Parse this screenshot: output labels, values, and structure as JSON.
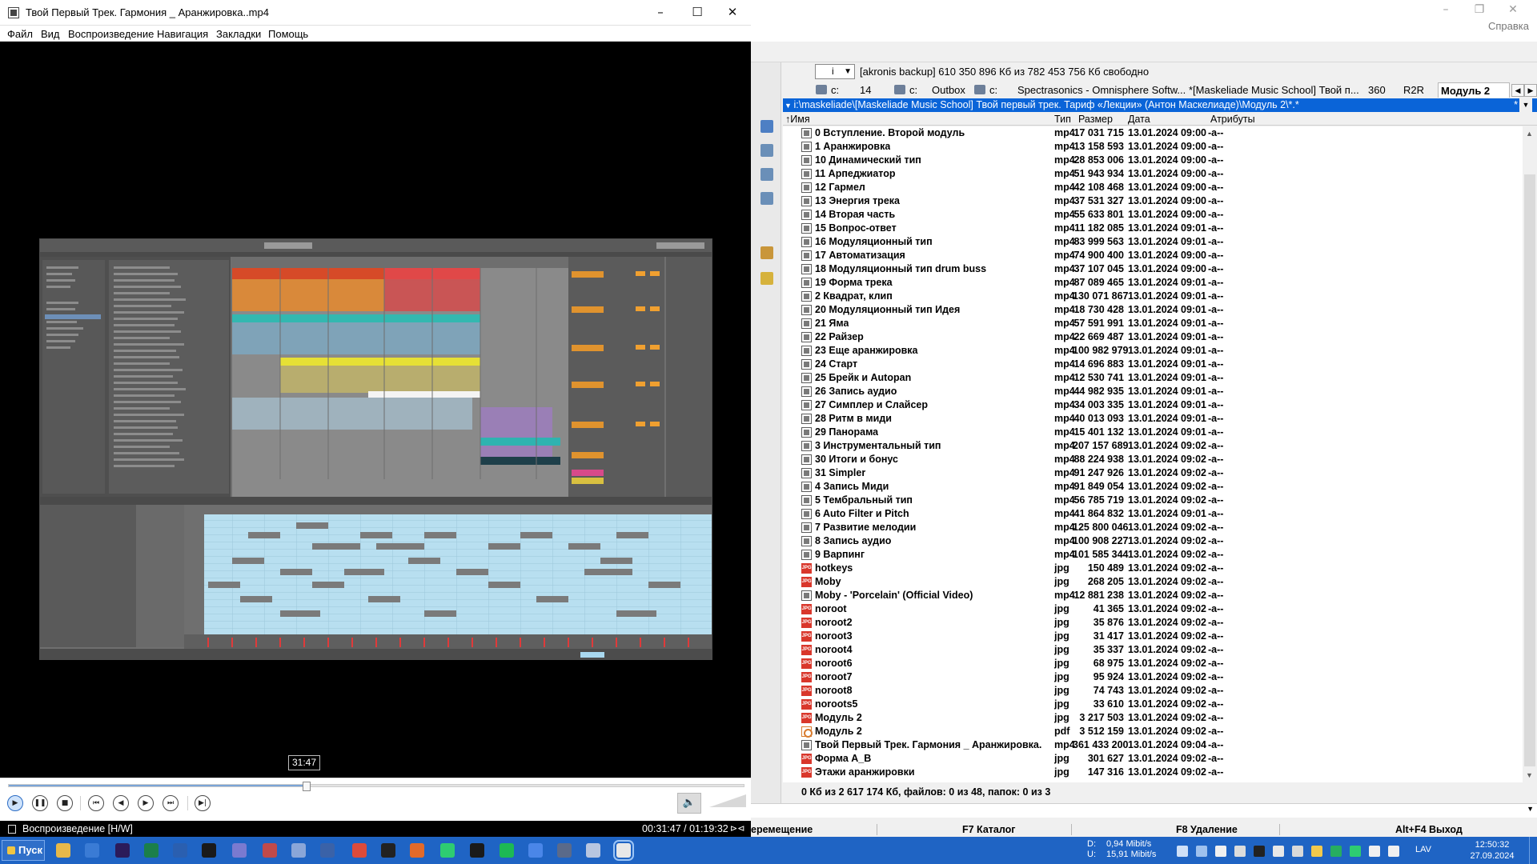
{
  "file_manager": {
    "help_label": "Справка",
    "drive": {
      "selected": "i",
      "info": "[akronis backup]  610 350 896 Кб из 782 453 756 Кб свободно",
      "root": "\\",
      "parent": ".."
    },
    "tabs": [
      {
        "label": "c:"
      },
      {
        "label": "14"
      },
      {
        "label": "c:"
      },
      {
        "label": "Outbox"
      },
      {
        "label": "c:"
      },
      {
        "label": "Spectrasonics - Omnisphere Softw..."
      },
      {
        "label": "*[Maskeliade Music School] Твой п..."
      },
      {
        "label": "360"
      },
      {
        "label": "R2R"
      },
      {
        "label": "Модуль 2"
      }
    ],
    "path": "i:\\maskeliade\\[Maskeliade Music School] Твой первый трек. Тариф «Лекции» (Антон Маскелиаде)\\Модуль 2\\*.*",
    "path_filter": "*",
    "columns": {
      "name": "↑Имя",
      "type": "Тип",
      "size": "Размер",
      "date": "Дата",
      "attrs": "Атрибуты"
    },
    "files": [
      {
        "name": "0 Вступление. Второй модуль",
        "type": "mp4",
        "size": "17 031 715",
        "date": "13.01.2024 09:00",
        "attrs": "-a--",
        "icon": "video-file-icon"
      },
      {
        "name": "1 Аранжировка",
        "type": "mp4",
        "size": "13 158 593",
        "date": "13.01.2024 09:00",
        "attrs": "-a--",
        "icon": "video-file-icon"
      },
      {
        "name": "10 Динамический тип",
        "type": "mp4",
        "size": "28 853 006",
        "date": "13.01.2024 09:00",
        "attrs": "-a--",
        "icon": "video-file-icon"
      },
      {
        "name": "11 Арпеджиатор",
        "type": "mp4",
        "size": "51 943 934",
        "date": "13.01.2024 09:00",
        "attrs": "-a--",
        "icon": "video-file-icon"
      },
      {
        "name": "12 Гармел",
        "type": "mp4",
        "size": "42 108 468",
        "date": "13.01.2024 09:00",
        "attrs": "-a--",
        "icon": "video-file-icon"
      },
      {
        "name": "13 Энергия трека",
        "type": "mp4",
        "size": "37 531 327",
        "date": "13.01.2024 09:00",
        "attrs": "-a--",
        "icon": "video-file-icon"
      },
      {
        "name": "14 Вторая часть",
        "type": "mp4",
        "size": "55 633 801",
        "date": "13.01.2024 09:00",
        "attrs": "-a--",
        "icon": "video-file-icon"
      },
      {
        "name": "15 Вопрос-ответ",
        "type": "mp4",
        "size": "11 182 085",
        "date": "13.01.2024 09:01",
        "attrs": "-a--",
        "icon": "video-file-icon"
      },
      {
        "name": "16 Модуляционный тип",
        "type": "mp4",
        "size": "83 999 563",
        "date": "13.01.2024 09:01",
        "attrs": "-a--",
        "icon": "video-file-icon"
      },
      {
        "name": "17 Автоматизация",
        "type": "mp4",
        "size": "74 900 400",
        "date": "13.01.2024 09:00",
        "attrs": "-a--",
        "icon": "video-file-icon"
      },
      {
        "name": "18 Модуляционный тип drum buss",
        "type": "mp4",
        "size": "37 107 045",
        "date": "13.01.2024 09:00",
        "attrs": "-a--",
        "icon": "video-file-icon"
      },
      {
        "name": "19 Форма трека",
        "type": "mp4",
        "size": "87 089 465",
        "date": "13.01.2024 09:01",
        "attrs": "-a--",
        "icon": "video-file-icon"
      },
      {
        "name": "2 Квадрат, клип",
        "type": "mp4",
        "size": "130 071 867",
        "date": "13.01.2024 09:01",
        "attrs": "-a--",
        "icon": "video-file-icon"
      },
      {
        "name": "20 Модуляционный тип Идея",
        "type": "mp4",
        "size": "18 730 428",
        "date": "13.01.2024 09:01",
        "attrs": "-a--",
        "icon": "video-file-icon"
      },
      {
        "name": "21 Яма",
        "type": "mp4",
        "size": "57 591 991",
        "date": "13.01.2024 09:01",
        "attrs": "-a--",
        "icon": "video-file-icon"
      },
      {
        "name": "22 Райзер",
        "type": "mp4",
        "size": "22 669 487",
        "date": "13.01.2024 09:01",
        "attrs": "-a--",
        "icon": "video-file-icon"
      },
      {
        "name": "23 Еще аранжировка",
        "type": "mp4",
        "size": "100 982 979",
        "date": "13.01.2024 09:01",
        "attrs": "-a--",
        "icon": "video-file-icon"
      },
      {
        "name": "24 Старт",
        "type": "mp4",
        "size": "14 696 883",
        "date": "13.01.2024 09:01",
        "attrs": "-a--",
        "icon": "video-file-icon"
      },
      {
        "name": "25 Брейк и Autopan",
        "type": "mp4",
        "size": "12 530 741",
        "date": "13.01.2024 09:01",
        "attrs": "-a--",
        "icon": "video-file-icon"
      },
      {
        "name": "26 Запись аудио",
        "type": "mp4",
        "size": "44 982 935",
        "date": "13.01.2024 09:01",
        "attrs": "-a--",
        "icon": "video-file-icon"
      },
      {
        "name": "27 Симплер и Слайсер",
        "type": "mp4",
        "size": "34 003 335",
        "date": "13.01.2024 09:01",
        "attrs": "-a--",
        "icon": "video-file-icon"
      },
      {
        "name": "28 Ритм в миди",
        "type": "mp4",
        "size": "40 013 093",
        "date": "13.01.2024 09:01",
        "attrs": "-a--",
        "icon": "video-file-icon"
      },
      {
        "name": "29 Панорама",
        "type": "mp4",
        "size": "15 401 132",
        "date": "13.01.2024 09:01",
        "attrs": "-a--",
        "icon": "video-file-icon"
      },
      {
        "name": "3 Инструментальный тип",
        "type": "mp4",
        "size": "207 157 689",
        "date": "13.01.2024 09:02",
        "attrs": "-a--",
        "icon": "video-file-icon"
      },
      {
        "name": "30 Итоги и бонус",
        "type": "mp4",
        "size": "88 224 938",
        "date": "13.01.2024 09:02",
        "attrs": "-a--",
        "icon": "video-file-icon"
      },
      {
        "name": "31 Simpler",
        "type": "mp4",
        "size": "91 247 926",
        "date": "13.01.2024 09:02",
        "attrs": "-a--",
        "icon": "video-file-icon"
      },
      {
        "name": "4 Запись Миди",
        "type": "mp4",
        "size": "91 849 054",
        "date": "13.01.2024 09:02",
        "attrs": "-a--",
        "icon": "video-file-icon"
      },
      {
        "name": "5 Тембральный тип",
        "type": "mp4",
        "size": "56 785 719",
        "date": "13.01.2024 09:02",
        "attrs": "-a--",
        "icon": "video-file-icon"
      },
      {
        "name": "6 Auto Filter и Pitch",
        "type": "mp4",
        "size": "41 864 832",
        "date": "13.01.2024 09:01",
        "attrs": "-a--",
        "icon": "video-file-icon"
      },
      {
        "name": "7 Развитие мелодии",
        "type": "mp4",
        "size": "125 800 046",
        "date": "13.01.2024 09:02",
        "attrs": "-a--",
        "icon": "video-file-icon"
      },
      {
        "name": "8 Запись аудио",
        "type": "mp4",
        "size": "100 908 227",
        "date": "13.01.2024 09:02",
        "attrs": "-a--",
        "icon": "video-file-icon"
      },
      {
        "name": "9 Варпинг",
        "type": "mp4",
        "size": "101 585 344",
        "date": "13.01.2024 09:02",
        "attrs": "-a--",
        "icon": "video-file-icon"
      },
      {
        "name": "hotkeys",
        "type": "jpg",
        "size": "150 489",
        "date": "13.01.2024 09:02",
        "attrs": "-a--",
        "icon": "image-file-icon"
      },
      {
        "name": "Moby",
        "type": "jpg",
        "size": "268 205",
        "date": "13.01.2024 09:02",
        "attrs": "-a--",
        "icon": "image-file-icon"
      },
      {
        "name": "Moby - 'Porcelain' (Official Video)",
        "type": "mp4",
        "size": "12 881 238",
        "date": "13.01.2024 09:02",
        "attrs": "-a--",
        "icon": "video-file-icon"
      },
      {
        "name": "noroot",
        "type": "jpg",
        "size": "41 365",
        "date": "13.01.2024 09:02",
        "attrs": "-a--",
        "icon": "image-file-icon"
      },
      {
        "name": "noroot2",
        "type": "jpg",
        "size": "35 876",
        "date": "13.01.2024 09:02",
        "attrs": "-a--",
        "icon": "image-file-icon"
      },
      {
        "name": "noroot3",
        "type": "jpg",
        "size": "31 417",
        "date": "13.01.2024 09:02",
        "attrs": "-a--",
        "icon": "image-file-icon"
      },
      {
        "name": "noroot4",
        "type": "jpg",
        "size": "35 337",
        "date": "13.01.2024 09:02",
        "attrs": "-a--",
        "icon": "image-file-icon"
      },
      {
        "name": "noroot6",
        "type": "jpg",
        "size": "68 975",
        "date": "13.01.2024 09:02",
        "attrs": "-a--",
        "icon": "image-file-icon"
      },
      {
        "name": "noroot7",
        "type": "jpg",
        "size": "95 924",
        "date": "13.01.2024 09:02",
        "attrs": "-a--",
        "icon": "image-file-icon"
      },
      {
        "name": "noroot8",
        "type": "jpg",
        "size": "74 743",
        "date": "13.01.2024 09:02",
        "attrs": "-a--",
        "icon": "image-file-icon"
      },
      {
        "name": "noroots5",
        "type": "jpg",
        "size": "33 610",
        "date": "13.01.2024 09:02",
        "attrs": "-a--",
        "icon": "image-file-icon"
      },
      {
        "name": "Модуль 2",
        "type": "jpg",
        "size": "3 217 503",
        "date": "13.01.2024 09:02",
        "attrs": "-a--",
        "icon": "image-file-icon"
      },
      {
        "name": "Модуль 2",
        "type": "pdf",
        "size": "3 512 159",
        "date": "13.01.2024 09:02",
        "attrs": "-a--",
        "icon": "pdf-file-icon"
      },
      {
        "name": "Твой Первый Трек. Гармония _ Аранжировка.",
        "type": "mp4",
        "size": "361 433 200",
        "date": "13.01.2024 09:04",
        "attrs": "-a--",
        "icon": "video-file-icon"
      },
      {
        "name": "Форма A_B",
        "type": "jpg",
        "size": "301 627",
        "date": "13.01.2024 09:02",
        "attrs": "-a--",
        "icon": "image-file-icon"
      },
      {
        "name": "Этажи аранжировки",
        "type": "jpg",
        "size": "147 316",
        "date": "13.01.2024 09:02",
        "attrs": "-a--",
        "icon": "image-file-icon"
      }
    ],
    "status": "0 Кб из 2 617 174 Кб, файлов: 0 из 48, папок: 0 из 3",
    "fkeys": [
      "еремещение",
      "F7 Каталог",
      "F8 Удаление",
      "Alt+F4 Выход"
    ]
  },
  "player": {
    "title": "Твой Первый Трек. Гармония _ Аранжировка..mp4",
    "menu": [
      "Файл",
      "Вид",
      "Воспроизведение",
      "Навигация",
      "Закладки",
      "Помощь"
    ],
    "seek_tooltip": "31:47",
    "progress": 0.4047,
    "status": "Воспроизведение [H/W]",
    "time": "00:31:47 / 01:19:32",
    "controls": [
      "play",
      "pause",
      "stop",
      "prev",
      "rewind",
      "forward",
      "next",
      "frame-step"
    ]
  },
  "taskbar": {
    "start": "Пуск",
    "net_down_label": "D:",
    "net_up_label": "U:",
    "net_down": "0,94 Mibit/s",
    "net_up": "15,91 Mibit/s",
    "lang": "LAV",
    "time": "12:50:32",
    "date": "27.09.2024"
  }
}
